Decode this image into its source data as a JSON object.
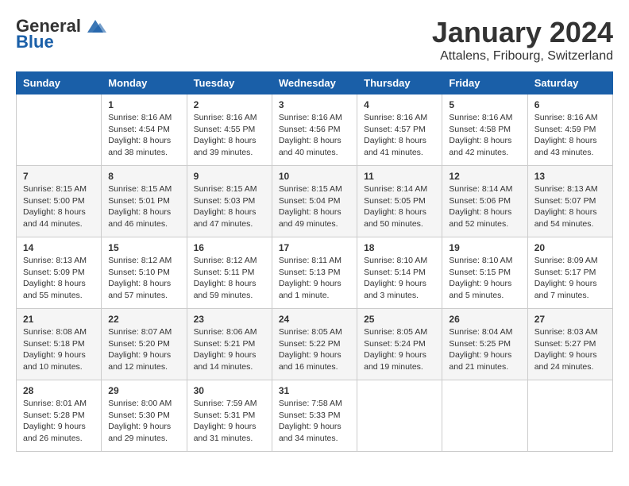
{
  "header": {
    "logo_general": "General",
    "logo_blue": "Blue",
    "month": "January 2024",
    "location": "Attalens, Fribourg, Switzerland"
  },
  "weekdays": [
    "Sunday",
    "Monday",
    "Tuesday",
    "Wednesday",
    "Thursday",
    "Friday",
    "Saturday"
  ],
  "weeks": [
    [
      {
        "day": "",
        "info": ""
      },
      {
        "day": "1",
        "info": "Sunrise: 8:16 AM\nSunset: 4:54 PM\nDaylight: 8 hours\nand 38 minutes."
      },
      {
        "day": "2",
        "info": "Sunrise: 8:16 AM\nSunset: 4:55 PM\nDaylight: 8 hours\nand 39 minutes."
      },
      {
        "day": "3",
        "info": "Sunrise: 8:16 AM\nSunset: 4:56 PM\nDaylight: 8 hours\nand 40 minutes."
      },
      {
        "day": "4",
        "info": "Sunrise: 8:16 AM\nSunset: 4:57 PM\nDaylight: 8 hours\nand 41 minutes."
      },
      {
        "day": "5",
        "info": "Sunrise: 8:16 AM\nSunset: 4:58 PM\nDaylight: 8 hours\nand 42 minutes."
      },
      {
        "day": "6",
        "info": "Sunrise: 8:16 AM\nSunset: 4:59 PM\nDaylight: 8 hours\nand 43 minutes."
      }
    ],
    [
      {
        "day": "7",
        "info": "Sunrise: 8:15 AM\nSunset: 5:00 PM\nDaylight: 8 hours\nand 44 minutes."
      },
      {
        "day": "8",
        "info": "Sunrise: 8:15 AM\nSunset: 5:01 PM\nDaylight: 8 hours\nand 46 minutes."
      },
      {
        "day": "9",
        "info": "Sunrise: 8:15 AM\nSunset: 5:03 PM\nDaylight: 8 hours\nand 47 minutes."
      },
      {
        "day": "10",
        "info": "Sunrise: 8:15 AM\nSunset: 5:04 PM\nDaylight: 8 hours\nand 49 minutes."
      },
      {
        "day": "11",
        "info": "Sunrise: 8:14 AM\nSunset: 5:05 PM\nDaylight: 8 hours\nand 50 minutes."
      },
      {
        "day": "12",
        "info": "Sunrise: 8:14 AM\nSunset: 5:06 PM\nDaylight: 8 hours\nand 52 minutes."
      },
      {
        "day": "13",
        "info": "Sunrise: 8:13 AM\nSunset: 5:07 PM\nDaylight: 8 hours\nand 54 minutes."
      }
    ],
    [
      {
        "day": "14",
        "info": "Sunrise: 8:13 AM\nSunset: 5:09 PM\nDaylight: 8 hours\nand 55 minutes."
      },
      {
        "day": "15",
        "info": "Sunrise: 8:12 AM\nSunset: 5:10 PM\nDaylight: 8 hours\nand 57 minutes."
      },
      {
        "day": "16",
        "info": "Sunrise: 8:12 AM\nSunset: 5:11 PM\nDaylight: 8 hours\nand 59 minutes."
      },
      {
        "day": "17",
        "info": "Sunrise: 8:11 AM\nSunset: 5:13 PM\nDaylight: 9 hours\nand 1 minute."
      },
      {
        "day": "18",
        "info": "Sunrise: 8:10 AM\nSunset: 5:14 PM\nDaylight: 9 hours\nand 3 minutes."
      },
      {
        "day": "19",
        "info": "Sunrise: 8:10 AM\nSunset: 5:15 PM\nDaylight: 9 hours\nand 5 minutes."
      },
      {
        "day": "20",
        "info": "Sunrise: 8:09 AM\nSunset: 5:17 PM\nDaylight: 9 hours\nand 7 minutes."
      }
    ],
    [
      {
        "day": "21",
        "info": "Sunrise: 8:08 AM\nSunset: 5:18 PM\nDaylight: 9 hours\nand 10 minutes."
      },
      {
        "day": "22",
        "info": "Sunrise: 8:07 AM\nSunset: 5:20 PM\nDaylight: 9 hours\nand 12 minutes."
      },
      {
        "day": "23",
        "info": "Sunrise: 8:06 AM\nSunset: 5:21 PM\nDaylight: 9 hours\nand 14 minutes."
      },
      {
        "day": "24",
        "info": "Sunrise: 8:05 AM\nSunset: 5:22 PM\nDaylight: 9 hours\nand 16 minutes."
      },
      {
        "day": "25",
        "info": "Sunrise: 8:05 AM\nSunset: 5:24 PM\nDaylight: 9 hours\nand 19 minutes."
      },
      {
        "day": "26",
        "info": "Sunrise: 8:04 AM\nSunset: 5:25 PM\nDaylight: 9 hours\nand 21 minutes."
      },
      {
        "day": "27",
        "info": "Sunrise: 8:03 AM\nSunset: 5:27 PM\nDaylight: 9 hours\nand 24 minutes."
      }
    ],
    [
      {
        "day": "28",
        "info": "Sunrise: 8:01 AM\nSunset: 5:28 PM\nDaylight: 9 hours\nand 26 minutes."
      },
      {
        "day": "29",
        "info": "Sunrise: 8:00 AM\nSunset: 5:30 PM\nDaylight: 9 hours\nand 29 minutes."
      },
      {
        "day": "30",
        "info": "Sunrise: 7:59 AM\nSunset: 5:31 PM\nDaylight: 9 hours\nand 31 minutes."
      },
      {
        "day": "31",
        "info": "Sunrise: 7:58 AM\nSunset: 5:33 PM\nDaylight: 9 hours\nand 34 minutes."
      },
      {
        "day": "",
        "info": ""
      },
      {
        "day": "",
        "info": ""
      },
      {
        "day": "",
        "info": ""
      }
    ]
  ]
}
